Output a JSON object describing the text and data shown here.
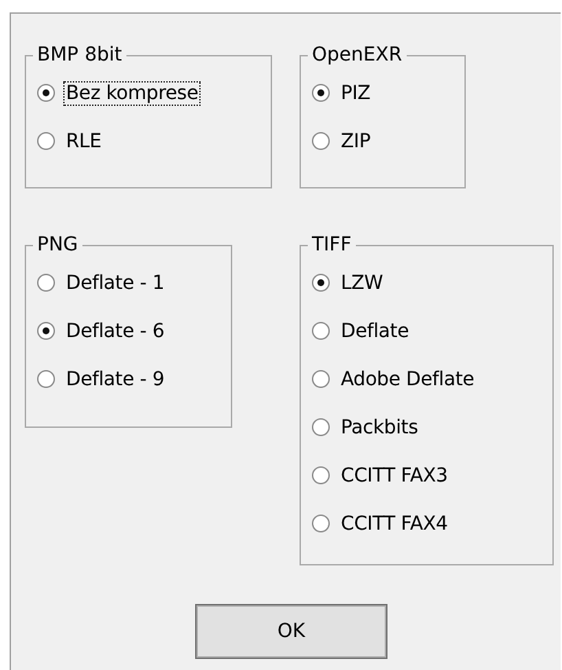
{
  "groups": [
    {
      "title": "BMP 8bit",
      "options": [
        {
          "label": "Bez komprese",
          "selected": true,
          "focused": true
        },
        {
          "label": "RLE",
          "selected": false,
          "focused": false
        }
      ]
    },
    {
      "title": "OpenEXR",
      "options": [
        {
          "label": "PIZ",
          "selected": true,
          "focused": false
        },
        {
          "label": "ZIP",
          "selected": false,
          "focused": false
        }
      ]
    },
    {
      "title": "PNG",
      "options": [
        {
          "label": "Deflate - 1",
          "selected": false,
          "focused": false
        },
        {
          "label": "Deflate - 6",
          "selected": true,
          "focused": false
        },
        {
          "label": "Deflate - 9",
          "selected": false,
          "focused": false
        }
      ]
    },
    {
      "title": "TIFF",
      "options": [
        {
          "label": "LZW",
          "selected": true,
          "focused": false
        },
        {
          "label": "Deflate",
          "selected": false,
          "focused": false
        },
        {
          "label": "Adobe Deflate",
          "selected": false,
          "focused": false
        },
        {
          "label": "Packbits",
          "selected": false,
          "focused": false
        },
        {
          "label": "CCITT FAX3",
          "selected": false,
          "focused": false
        },
        {
          "label": "CCITT FAX4",
          "selected": false,
          "focused": false
        }
      ]
    }
  ],
  "button": {
    "label": "OK"
  }
}
